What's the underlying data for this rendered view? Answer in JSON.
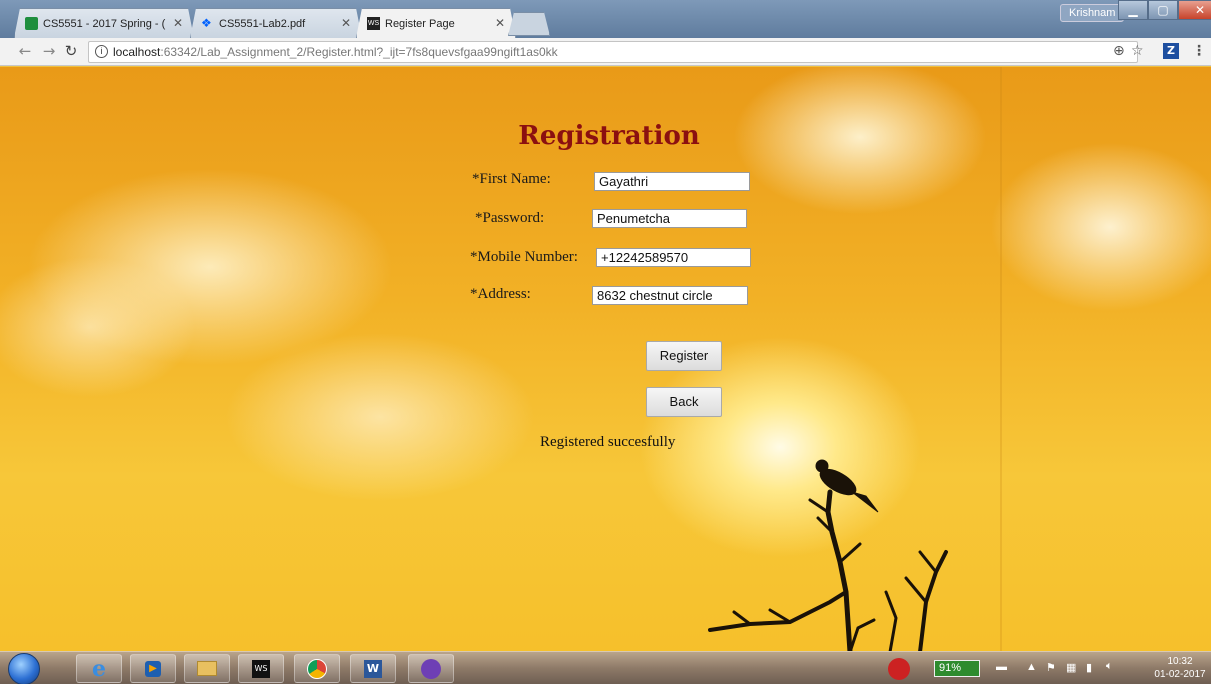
{
  "browser": {
    "tabs": [
      {
        "label": "CS5551 - 2017 Spring - (",
        "icon": "sheets-icon"
      },
      {
        "label": "CS5551-Lab2.pdf",
        "icon": "dropbox-icon"
      },
      {
        "label": "Register Page",
        "icon": "webstorm-icon"
      }
    ],
    "user": "Krishnam",
    "url_host": "localhost",
    "url_rest": ":63342/Lab_Assignment_2/Register.html?_ijt=7fs8quevsfgaa99ngift1as0kk",
    "colors": {
      "accent": "#8b1010",
      "background": "#f2b126"
    }
  },
  "page": {
    "title": "Registration",
    "fields": {
      "first_name": {
        "label": "*First Name:",
        "value": "Gayathri"
      },
      "password": {
        "label": "*Password:",
        "value": "Penumetcha"
      },
      "mobile": {
        "label": "*Mobile Number:",
        "value": "+12242589570"
      },
      "address": {
        "label": "*Address:",
        "value": "8632 chestnut circle"
      }
    },
    "register_label": "Register",
    "back_label": "Back",
    "status": "Registered succesfully"
  },
  "taskbar": {
    "battery": "91%",
    "time": "10:32",
    "date": "01-02-2017"
  }
}
